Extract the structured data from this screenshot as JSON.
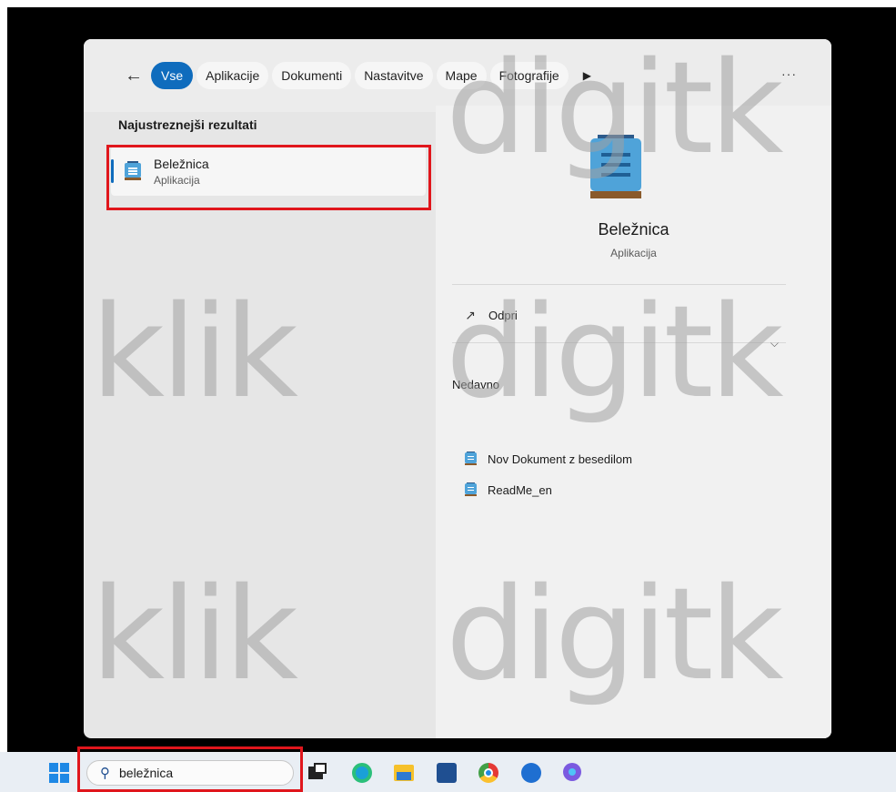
{
  "filter_bar": {
    "back_icon": "arrow-left-icon",
    "tabs": [
      {
        "label": "Vse",
        "active": true
      },
      {
        "label": "Aplikacije"
      },
      {
        "label": "Dokumenti"
      },
      {
        "label": "Nastavitve"
      },
      {
        "label": "Mape"
      },
      {
        "label": "Fotografije"
      }
    ],
    "more_label": "···"
  },
  "results": {
    "section_title": "Najustreznejši rezultati",
    "best_match": {
      "name": "Beležnica",
      "type": "Aplikacija",
      "icon": "notepad-icon"
    }
  },
  "detail": {
    "name": "Beležnica",
    "type": "Aplikacija",
    "open_label": "Odpri",
    "open_icon": "open-external-icon",
    "recent_title": "Nedavno",
    "recent_items": [
      {
        "label": "Nov Dokument z besedilom",
        "icon": "notepad-icon"
      },
      {
        "label": "ReadMe_en",
        "icon": "notepad-icon"
      }
    ]
  },
  "taskbar": {
    "search_value": "beležnica",
    "apps": [
      "task-view-icon",
      "edge-icon",
      "file-explorer-icon",
      "store-icon",
      "chrome-icon",
      "thunderbird-icon",
      "chrome-canary-icon"
    ]
  },
  "colors": {
    "accent": "#0f6cbd",
    "highlight": "#e0161c"
  },
  "watermark": {
    "row1": "klik",
    "row2": "digitk"
  }
}
